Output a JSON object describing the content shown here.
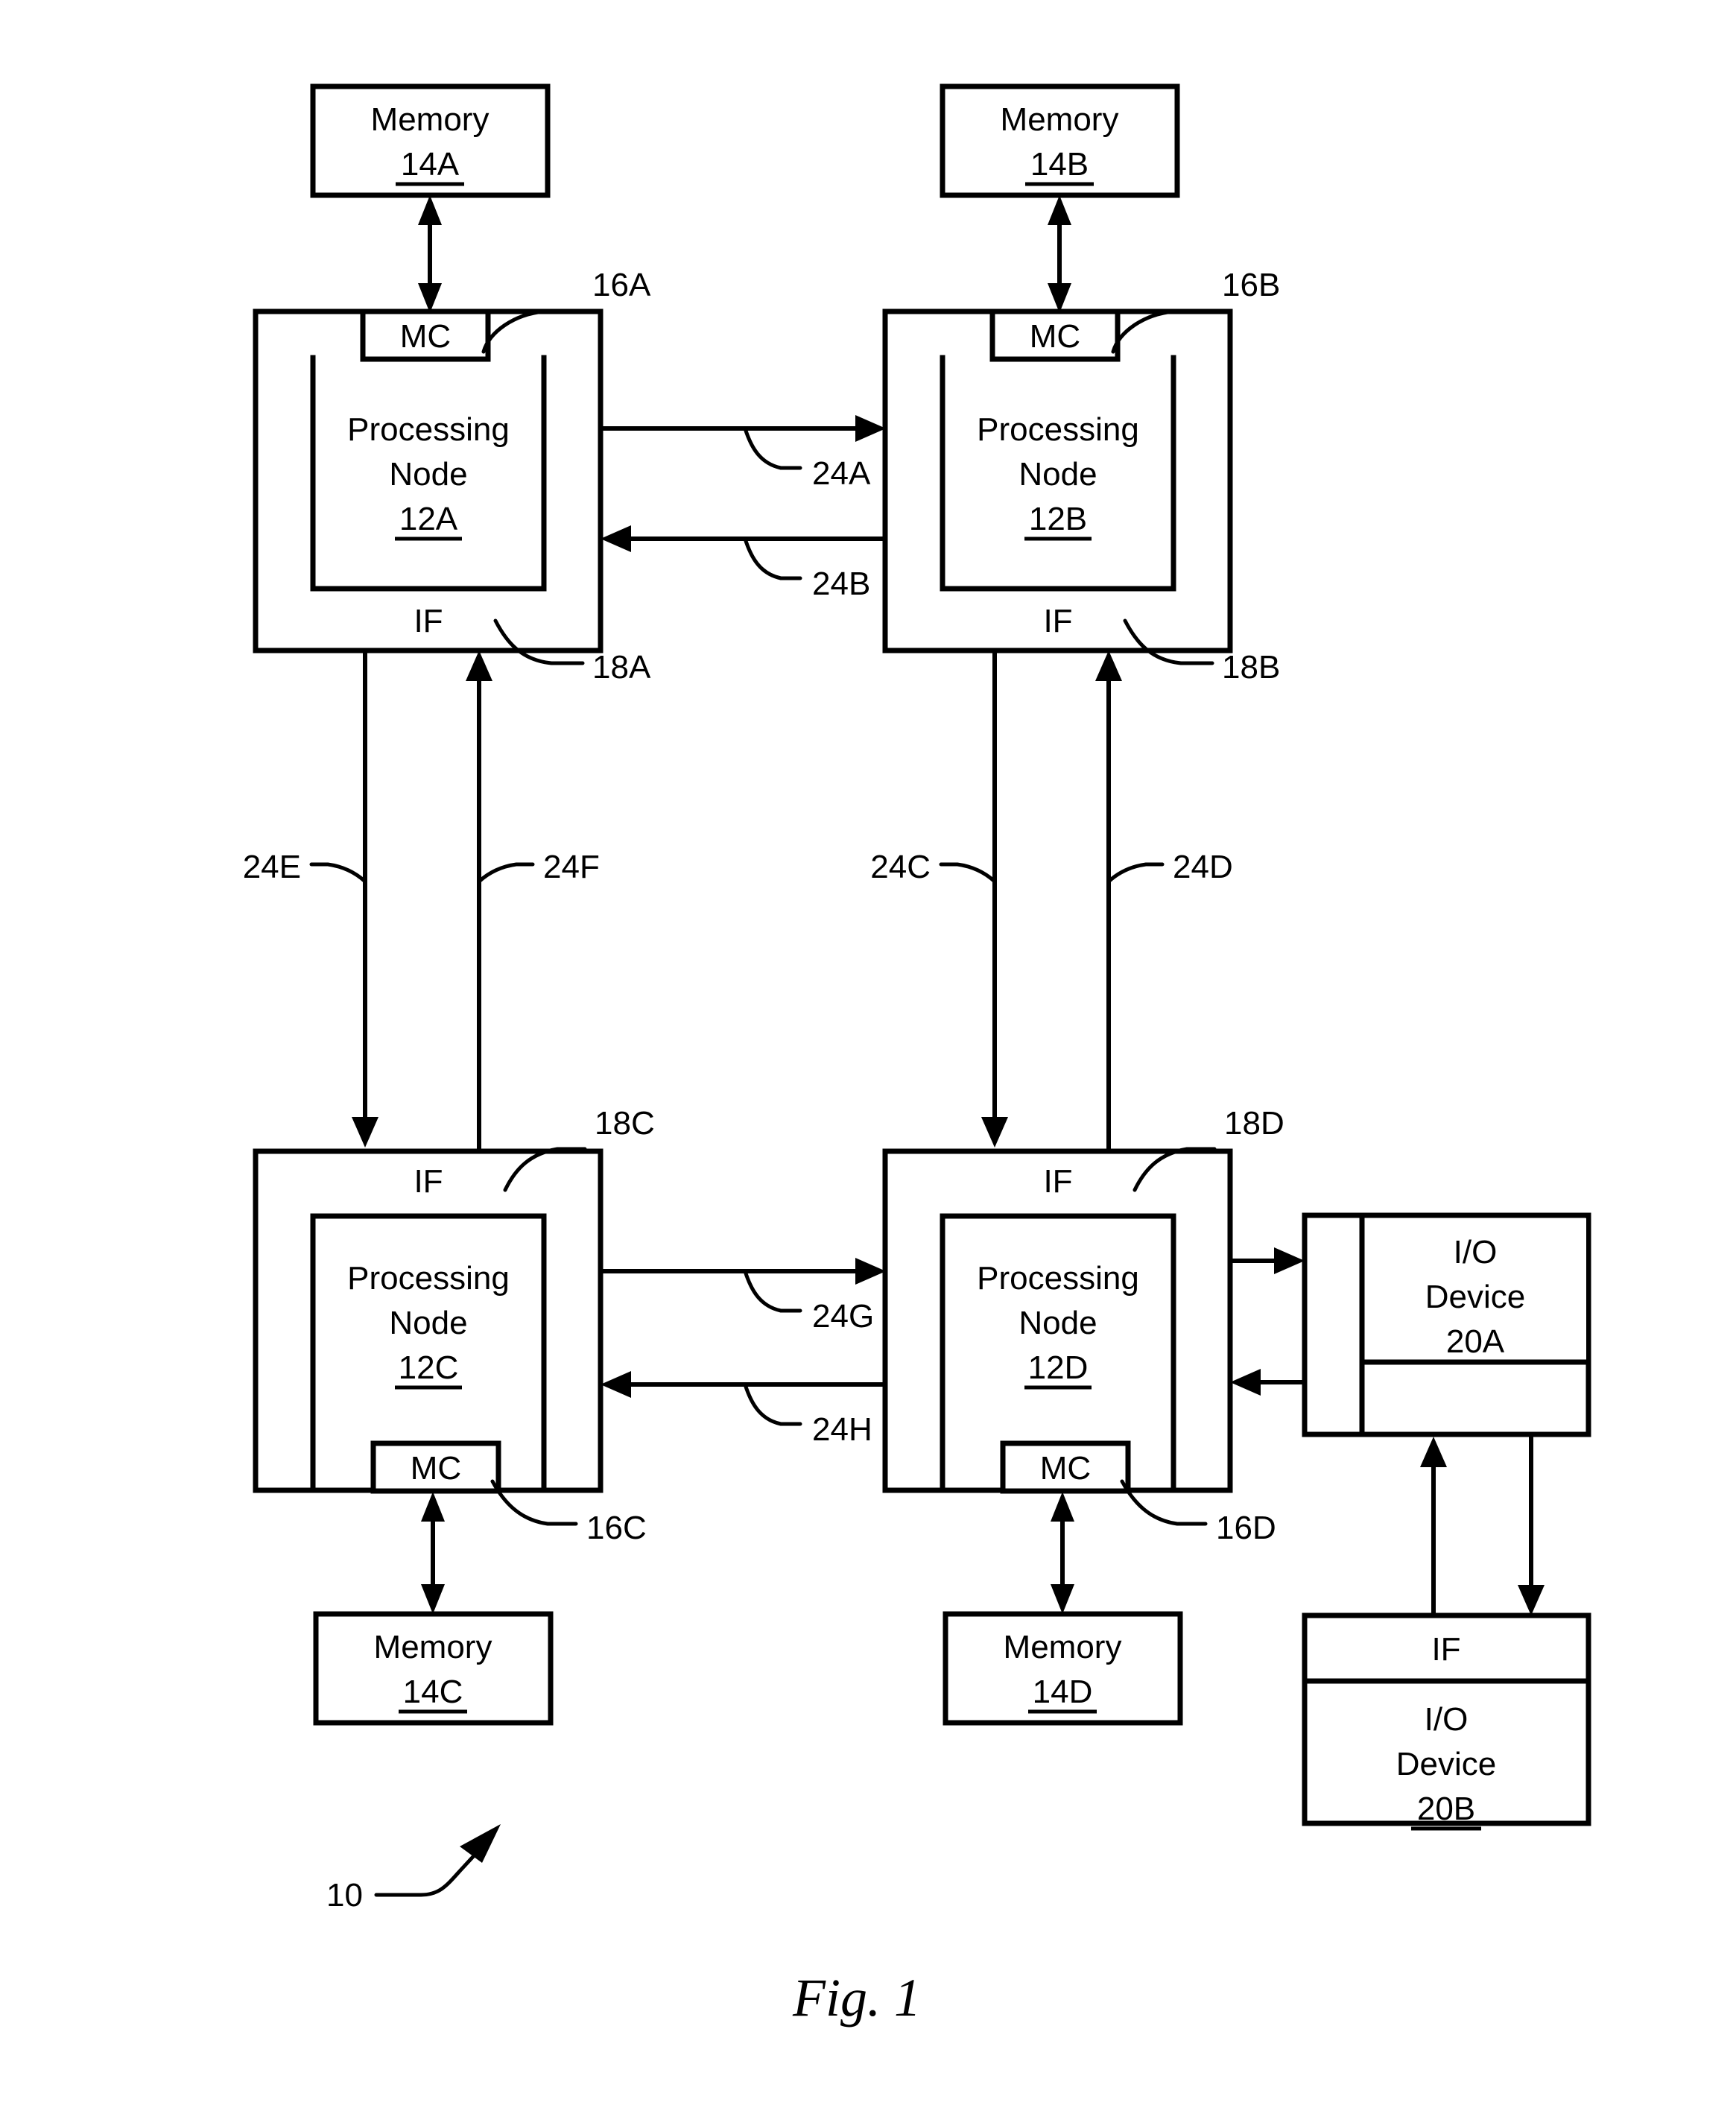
{
  "figure": {
    "title": "Fig. 1",
    "system_ref": "10"
  },
  "memories": [
    {
      "name": "Memory",
      "ref": "14A"
    },
    {
      "name": "Memory",
      "ref": "14B"
    },
    {
      "name": "Memory",
      "ref": "14C"
    },
    {
      "name": "Memory",
      "ref": "14D"
    }
  ],
  "nodes": [
    {
      "name_line1": "Processing",
      "name_line2": "Node",
      "ref": "12A",
      "mc_label": "MC",
      "mc_ref": "16A",
      "if_label": "IF",
      "if_ref": "18A"
    },
    {
      "name_line1": "Processing",
      "name_line2": "Node",
      "ref": "12B",
      "mc_label": "MC",
      "mc_ref": "16B",
      "if_label": "IF",
      "if_ref": "18B"
    },
    {
      "name_line1": "Processing",
      "name_line2": "Node",
      "ref": "12C",
      "mc_label": "MC",
      "mc_ref": "16C",
      "if_label": "IF",
      "if_ref": "18C"
    },
    {
      "name_line1": "Processing",
      "name_line2": "Node",
      "ref": "12D",
      "mc_label": "MC",
      "mc_ref": "16D",
      "if_label": "IF",
      "if_ref": "18D"
    }
  ],
  "io_devices": [
    {
      "name_line1": "I/O",
      "name_line2": "Device",
      "ref": "20A"
    },
    {
      "name_line1": "I/O",
      "name_line2": "Device",
      "ref": "20B",
      "if_label": "IF"
    }
  ],
  "links": [
    {
      "ref": "24A",
      "from": "12A",
      "to": "12B",
      "direction": "right"
    },
    {
      "ref": "24B",
      "from": "12B",
      "to": "12A",
      "direction": "left"
    },
    {
      "ref": "24C",
      "from": "12B",
      "to": "12D",
      "direction": "down"
    },
    {
      "ref": "24D",
      "from": "12D",
      "to": "12B",
      "direction": "up"
    },
    {
      "ref": "24E",
      "from": "12A",
      "to": "12C",
      "direction": "down"
    },
    {
      "ref": "24F",
      "from": "12C",
      "to": "12A",
      "direction": "up"
    },
    {
      "ref": "24G",
      "from": "12C",
      "to": "12D",
      "direction": "right"
    },
    {
      "ref": "24H",
      "from": "12D",
      "to": "12C",
      "direction": "left"
    }
  ],
  "colors": {
    "line": "#000000",
    "background": "#ffffff"
  }
}
